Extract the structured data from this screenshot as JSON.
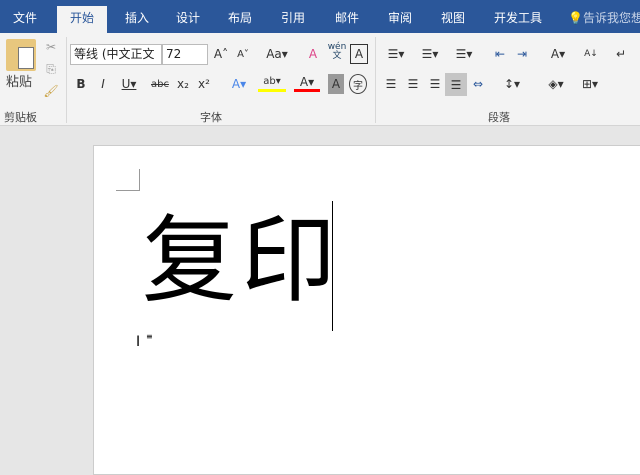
{
  "tabs": [
    "文件",
    "开始",
    "插入",
    "设计",
    "布局",
    "引用",
    "邮件",
    "审阅",
    "视图",
    "开发工具"
  ],
  "active_tab": "开始",
  "tell_me": "告诉我您想",
  "clipboard": {
    "paste": "粘贴",
    "group": "剪贴板"
  },
  "font": {
    "name": "等线 (中文正文",
    "size": "72",
    "group": "字体",
    "case_label": "Aa",
    "phonetic": "wén"
  },
  "paragraph": {
    "group": "段落"
  },
  "colors": {
    "accent": "#2b579a",
    "highlight": "#ffff00",
    "font_color": "#ff0000"
  },
  "document": {
    "text": "复印"
  }
}
